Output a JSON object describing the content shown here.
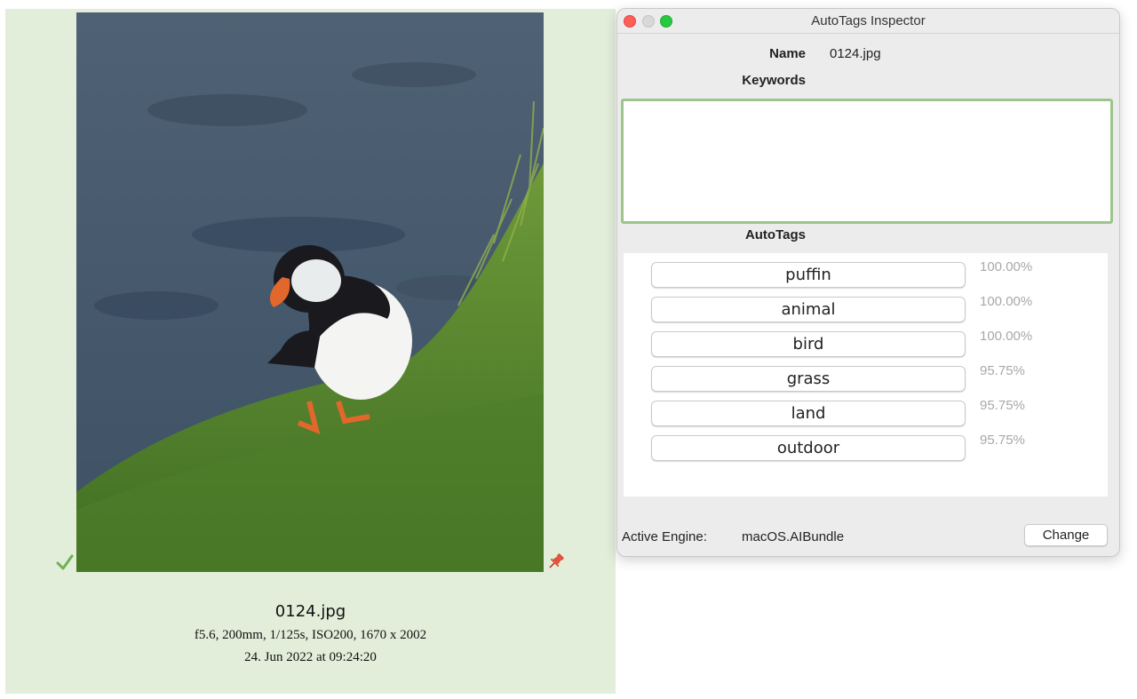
{
  "thumbnail": {
    "file_name": "0124.jpg",
    "exif": "f5.6, 200mm, 1/125s, ISO200, 1670 x 2002",
    "date": "24. Jun 2022 at 09:24:20",
    "check_icon": "checkmark-icon",
    "pin_icon": "pin-icon"
  },
  "inspector": {
    "title": "AutoTags Inspector",
    "name_label": "Name",
    "name_value": "0124.jpg",
    "keywords_label": "Keywords",
    "keywords_value": "",
    "autotags_label": "AutoTags",
    "tags": [
      {
        "label": "puffin",
        "confidence": "100.00%"
      },
      {
        "label": "animal",
        "confidence": "100.00%"
      },
      {
        "label": "bird",
        "confidence": "100.00%"
      },
      {
        "label": "grass",
        "confidence": "95.75%"
      },
      {
        "label": "land",
        "confidence": "95.75%"
      },
      {
        "label": "outdoor",
        "confidence": "95.75%"
      }
    ],
    "engine_label": "Active Engine:",
    "engine_value": "macOS.AIBundle",
    "change_label": "Change"
  },
  "colors": {
    "card_bg": "#e2eeda",
    "keywords_border": "#9cc58b",
    "check": "#6fb255",
    "pin": "#e0523b",
    "close": "#fe5f57",
    "maximize": "#28c840"
  }
}
